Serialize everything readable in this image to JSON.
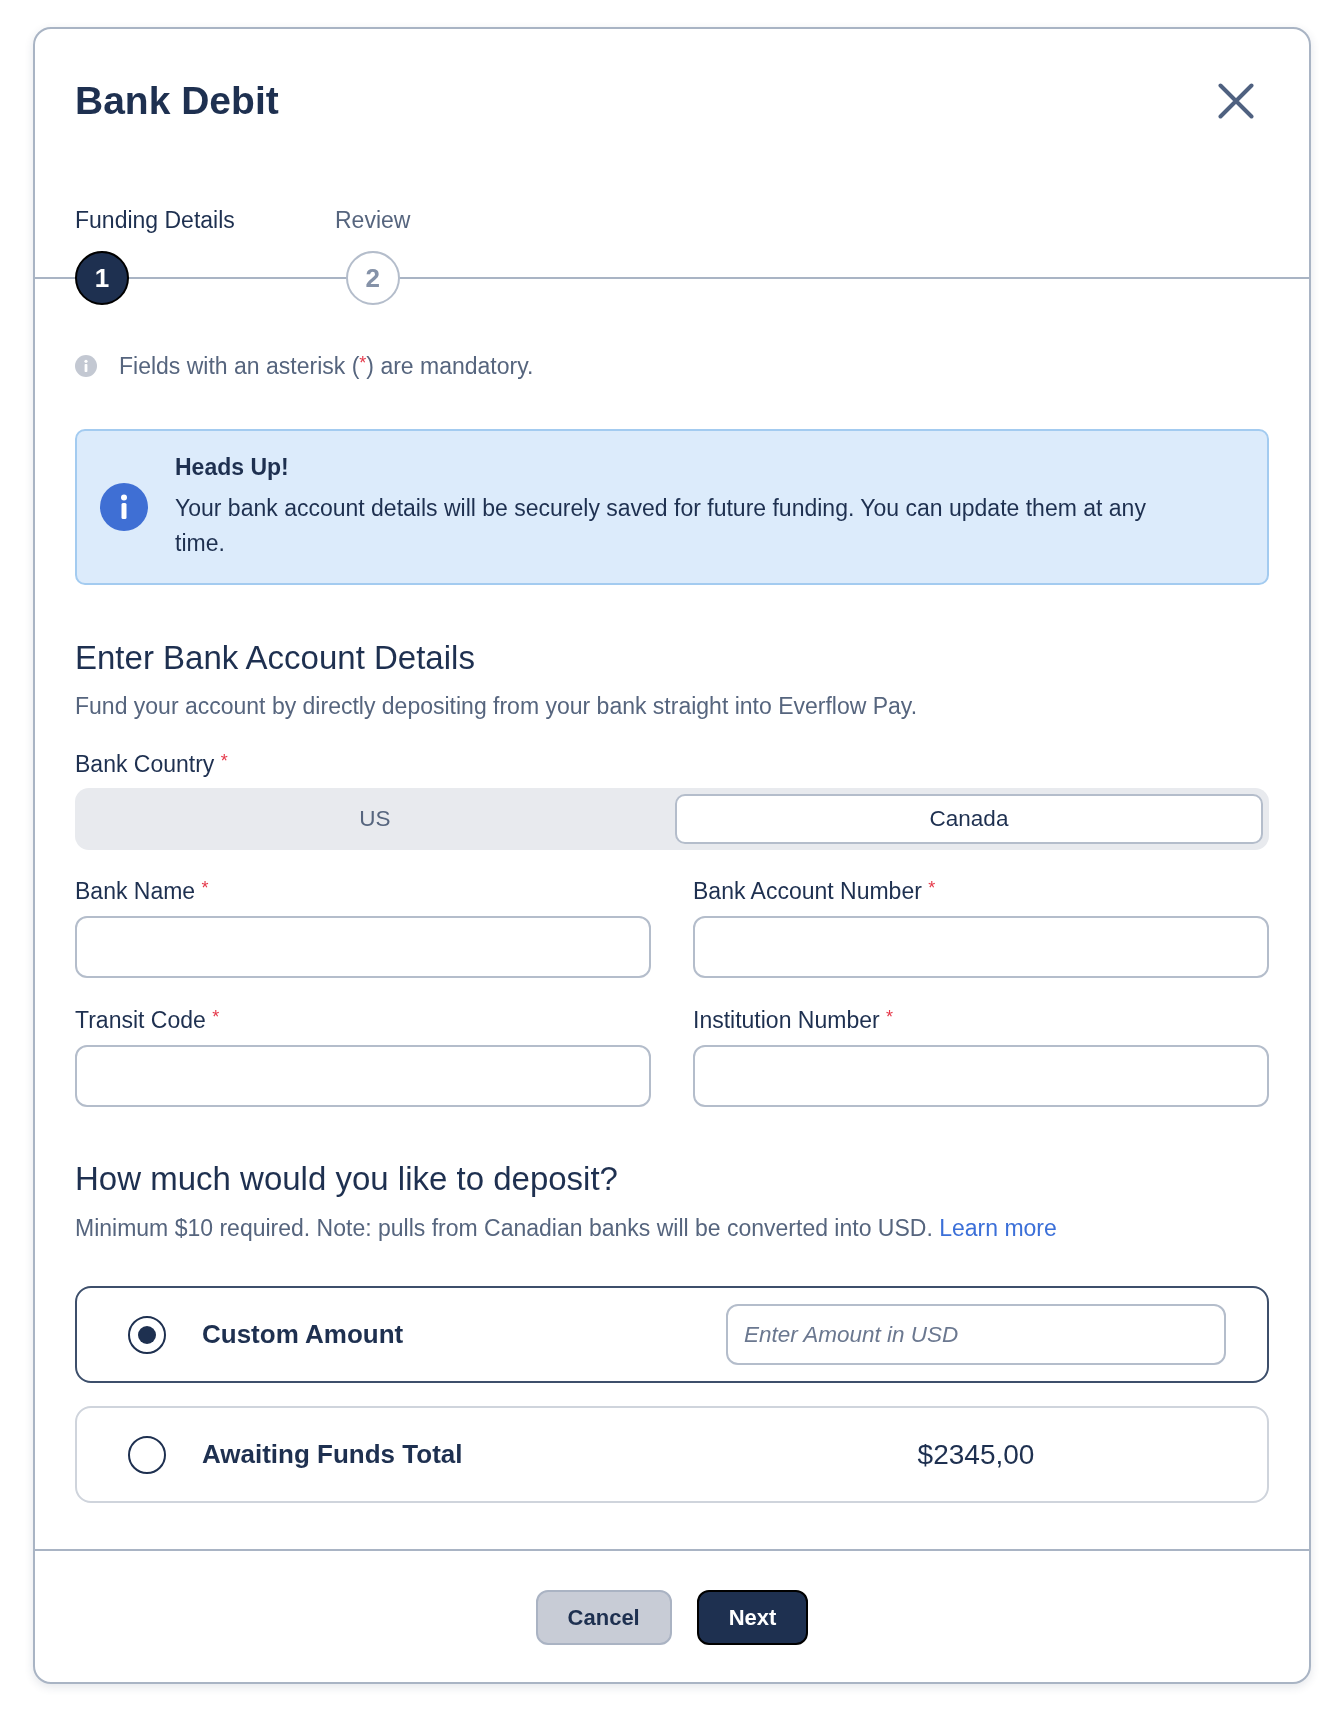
{
  "dialog": {
    "title": "Bank Debit"
  },
  "steps": [
    {
      "label": "Funding Details",
      "number": "1",
      "selected": true
    },
    {
      "label": "Review",
      "number": "2",
      "selected": false
    }
  ],
  "mandatory_note": {
    "before": "Fields with an asterisk (",
    "asterisk": "*",
    "after": ") are mandatory."
  },
  "alert": {
    "title": "Heads Up!",
    "message": "Your bank account details will be securely saved for future funding. You can update them at any time."
  },
  "bank_details": {
    "heading": "Enter Bank Account Details",
    "description": "Fund your account by directly depositing from your bank straight into Everflow Pay.",
    "country": {
      "label": "Bank Country",
      "asterisk": "*",
      "options": [
        {
          "label": "US",
          "selected": false
        },
        {
          "label": "Canada",
          "selected": true
        }
      ]
    },
    "fields": [
      {
        "label": "Bank Name",
        "asterisk": "*"
      },
      {
        "label": "Bank Account Number",
        "asterisk": "*"
      },
      {
        "label": "Transit Code",
        "asterisk": "*"
      },
      {
        "label": "Institution Number",
        "asterisk": "*"
      }
    ]
  },
  "deposit": {
    "heading": "How much would you like to deposit?",
    "description": "Minimum $10 required. Note: pulls from Canadian banks will be converted into USD.",
    "link": "Learn more",
    "options": [
      {
        "kind": "input",
        "label": "Custom Amount",
        "selected": true,
        "placeholder": "Enter Amount in USD"
      },
      {
        "kind": "amount",
        "label": "Awaiting Funds Total",
        "selected": false,
        "value": "$2345,00"
      }
    ]
  },
  "buttons": [
    {
      "label": "Cancel",
      "kind": "secondary"
    },
    {
      "label": "Next",
      "kind": "primary"
    }
  ]
}
